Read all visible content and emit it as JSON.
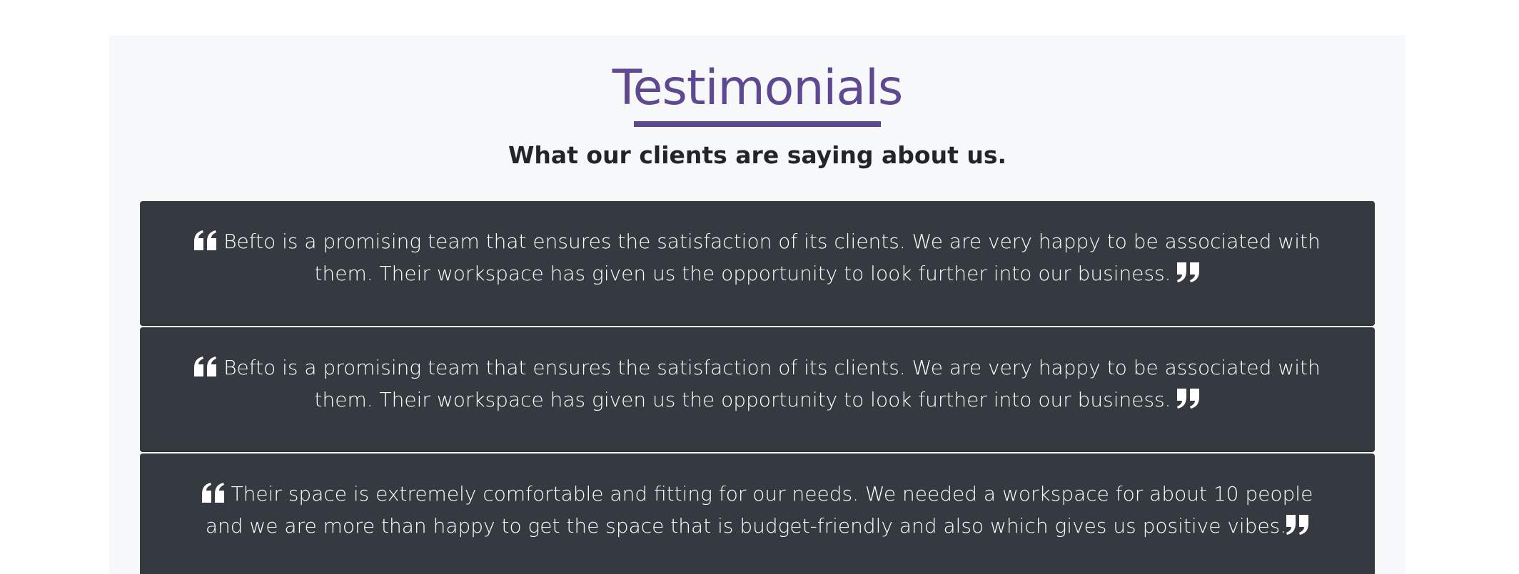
{
  "header": {
    "title": "Testimonials",
    "subtitle": "What our clients are saying about us."
  },
  "testimonials": [
    {
      "text": "Befto is a promising team that ensures the satisfaction of its clients. We are very happy to be associated with them. Their workspace has given us the opportunity to look further into our business."
    },
    {
      "text": "Befto is a promising team that ensures the satisfaction of its clients. We are very happy to be associated with them. Their workspace has given us the opportunity to look further into our business."
    },
    {
      "text": "Their space is extremely comfortable and fitting for our needs. We needed a workspace for about 10 people and we are more than happy to get the space that is budget-friendly and also which gives us positive vibes."
    }
  ],
  "icons": {
    "open": "quote-left-icon",
    "close": "quote-right-icon"
  },
  "colors": {
    "accent": "#5e4892",
    "card_bg": "#343a40",
    "section_bg": "#f7f8fa",
    "subtitle": "#212529"
  }
}
